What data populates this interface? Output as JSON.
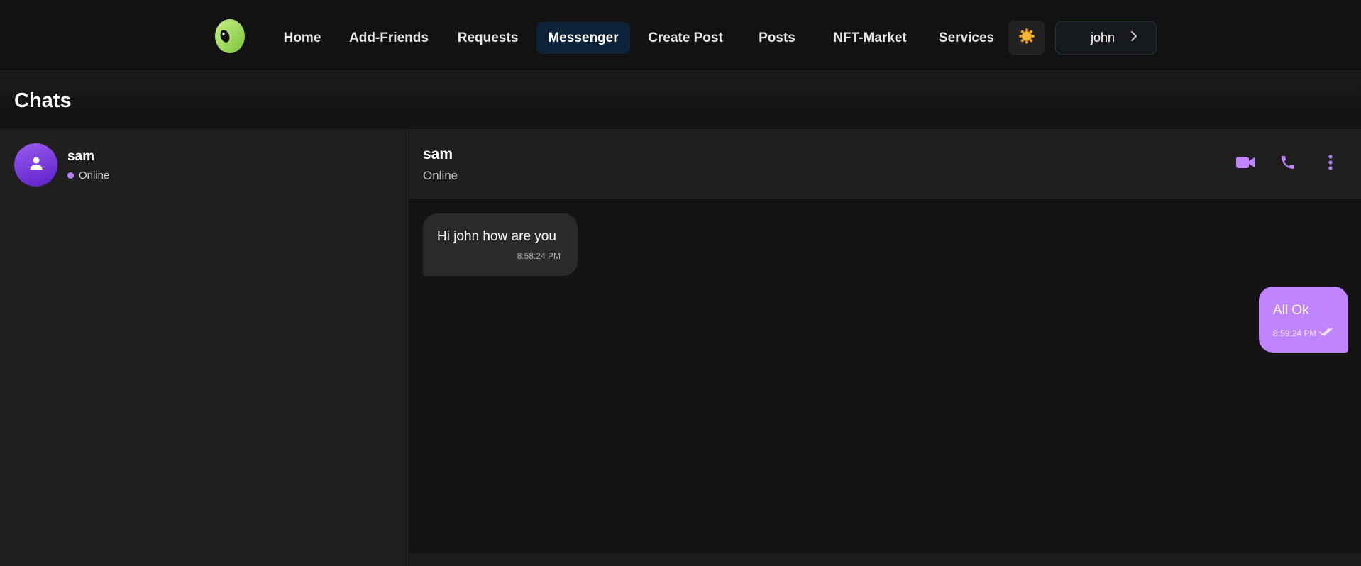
{
  "nav": {
    "items": [
      {
        "label": "Home"
      },
      {
        "label": "Add-Friends"
      },
      {
        "label": "Requests"
      },
      {
        "label": "Messenger",
        "active": true
      },
      {
        "label": "Create Post"
      },
      {
        "label": "Posts"
      },
      {
        "label": "NFT-Market"
      },
      {
        "label": "Services"
      }
    ],
    "theme_icon": "sun-icon",
    "user": {
      "name": "john",
      "icon": "chevron-right-icon"
    }
  },
  "chats": {
    "title": "Chats"
  },
  "contacts": [
    {
      "name": "sam",
      "status": "Online",
      "avatar_icon": "user-icon"
    }
  ],
  "chat": {
    "name": "sam",
    "status": "Online",
    "actions": [
      "video-camera-icon",
      "phone-icon",
      "more-vertical-icon"
    ],
    "messages": [
      {
        "direction": "incoming",
        "text": "Hi john how are you",
        "time": "8:58:24 PM"
      },
      {
        "direction": "outgoing",
        "text": "All Ok",
        "time": "8:59:24 PM",
        "read_icon": "double-check-icon"
      }
    ]
  },
  "colors": {
    "accent": "#c084fc",
    "active_nav": "#0c2239",
    "status_dot": "#bf80ff",
    "logo_green": "#a3e05c"
  }
}
